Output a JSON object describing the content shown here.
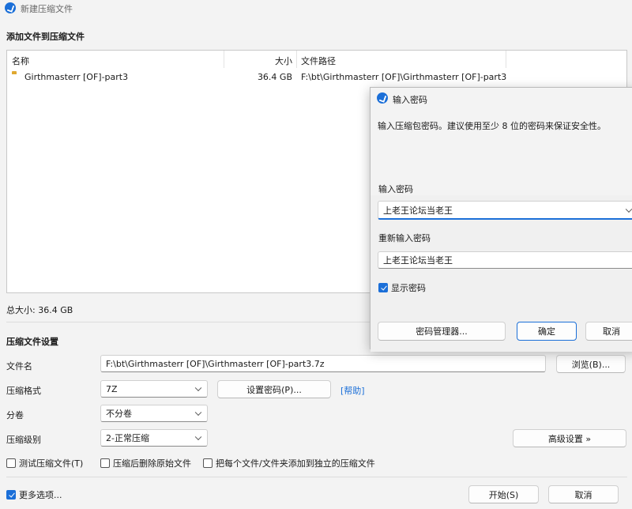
{
  "window": {
    "title": "新建压缩文件"
  },
  "files_section": {
    "heading": "添加文件到压缩文件",
    "columns": {
      "name": "名称",
      "size": "大小",
      "path": "文件路径"
    },
    "rows": [
      {
        "name": "Girthmasterr [OF]-part3",
        "size": "36.4 GB",
        "path": "F:\\bt\\Girthmasterr [OF]\\Girthmasterr [OF]-part3"
      }
    ],
    "total_size": "总大小: 36.4 GB"
  },
  "settings": {
    "heading": "压缩文件设置",
    "filename_label": "文件名",
    "filename_value": "F:\\bt\\Girthmasterr [OF]\\Girthmasterr [OF]-part3.7z",
    "browse_label": "浏览(B)...",
    "format_label": "压缩格式",
    "format_value": "7Z",
    "set_password_label": "设置密码(P)...",
    "help_label": "[帮助]",
    "split_label": "分卷",
    "split_value": "不分卷",
    "level_label": "压缩级别",
    "level_value": "2-正常压缩",
    "advanced_label": "高级设置 »",
    "test_label": "测试压缩文件(T)",
    "delete_label": "压缩后删除原始文件",
    "separate_label": "把每个文件/文件夹添加到独立的压缩文件"
  },
  "footer": {
    "more_options": "更多选项...",
    "start_label": "开始(S)",
    "cancel_label": "取消"
  },
  "dialog": {
    "title": "输入密码",
    "description": "输入压缩包密码。建议使用至少 8 位的密码来保证安全性。",
    "password_label": "输入密码",
    "password_value": "上老王论坛当老王",
    "repeat_label": "重新输入密码",
    "repeat_value": "上老王论坛当老王",
    "show_password_label": "显示密码",
    "manager_label": "密码管理器...",
    "ok_label": "确定",
    "cancel_label": "取消"
  },
  "colors": {
    "accent": "#1b6fd8",
    "folder": "#f2c14e"
  },
  "icons": [
    "app-icon",
    "folder-icon",
    "chevron-down-icon",
    "checkbox-icon"
  ]
}
